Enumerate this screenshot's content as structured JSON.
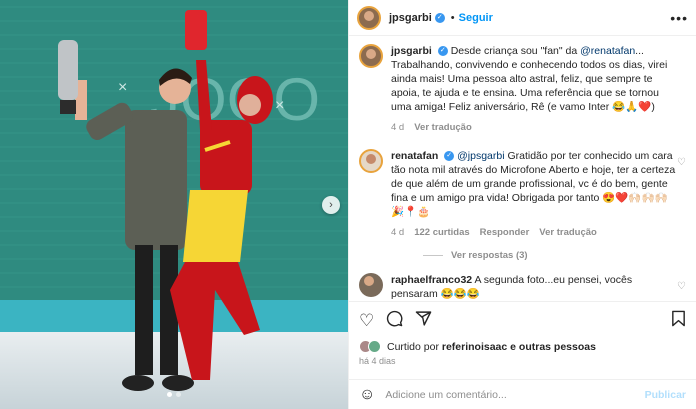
{
  "post": {
    "author": "jpsgarbi",
    "follow_label": "Seguir",
    "more_glyph": "•••"
  },
  "caption": {
    "author": "jpsgarbi",
    "mention": "@renatafan",
    "text_pre": "Desde criança sou \"fan\" da ",
    "text_post": "... Trabalhando, convivendo e conhecendo todos os dias, virei ainda mais! Uma pessoa alto astral, feliz, que sempre te apoia, te ajuda e te ensina. Uma referência que se tornou uma amiga! Feliz aniversário, Rê (e vamo Inter 😂🙏❤️)",
    "time": "4 d",
    "translate": "Ver tradução"
  },
  "comment1": {
    "author": "renatafan",
    "mention": "@jpsgarbi",
    "text": " Gratidão por ter conhecido um cara tão nota mil através do Microfone Aberto e hoje, ter a certeza de que além de um grande profissional, vc é do bem, gente fina e um amigo pra vida! Obrigada por tanto 😍❤️🙌🏻🙌🏻🙌🏻 🎉📍🎂",
    "time": "4 d",
    "likes": "122 curtidas",
    "reply": "Responder",
    "translate": "Ver tradução",
    "view_replies": "Ver respostas (3)"
  },
  "comment2": {
    "author": "raphaelfranco32",
    "text": " A segunda foto...eu pensei, vocês pensaram 😂😂😂"
  },
  "likes": {
    "prefix": "Curtido por ",
    "user": "referinoisaac",
    "suffix": " e outras pessoas",
    "date": "há 4 dias"
  },
  "add_comment": {
    "placeholder": "Adicione um comentário...",
    "publish": "Publicar"
  },
  "icons": {
    "like": "heart-icon",
    "comment": "comment-icon",
    "share": "share-icon",
    "save": "bookmark-icon",
    "emoji": "emoji-icon",
    "next": "chevron-right-icon"
  },
  "colors": {
    "accent": "#0095f6",
    "verified": "#3897f0",
    "studio_bg": "#2c7d73",
    "costume_red": "#c8151b",
    "costume_yellow": "#f6d635"
  }
}
